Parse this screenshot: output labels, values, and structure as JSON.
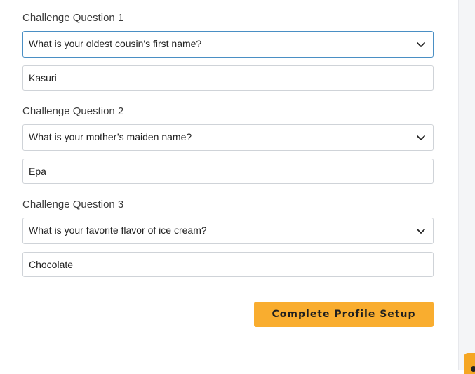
{
  "questions": [
    {
      "label": "Challenge Question 1",
      "selected": "What is your oldest cousin's first name?",
      "answer": "Kasuri"
    },
    {
      "label": "Challenge Question 2",
      "selected": "What is your mother’s maiden name?",
      "answer": "Epa"
    },
    {
      "label": "Challenge Question 3",
      "selected": "What is your favorite flavor of ice cream?",
      "answer": "Chocolate"
    }
  ],
  "submit_label": "Complete Profile Setup",
  "icons": {
    "dropdown": "chevron-down-icon"
  },
  "colors": {
    "accent": "#f9ad2f",
    "focus_border": "#4a8fc4"
  }
}
